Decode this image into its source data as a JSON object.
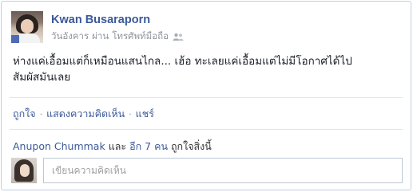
{
  "post": {
    "author": "Kwan Busaraporn",
    "day": "วันอังคาร",
    "via": "ผ่าน",
    "source": "โทรศัพท์มือถือ",
    "audience_icon": "friends-icon",
    "message_line1": "ห่างแค่เอื้อมแต่ก็เหมือนแสนไกล... เฮ้อ ทะเลยแค่เอื้อมแต่ไม่มีโอกาศได้ไป",
    "message_line2": "สัมผัสมันเลย"
  },
  "actions": {
    "like": "ถูกใจ",
    "comment": "แสดงความคิดเห็น",
    "share": "แชร์",
    "separator": "·"
  },
  "likes": {
    "liker": "Anupon Chummak",
    "and": "และ",
    "others": "อีก 7 คน",
    "suffix": "ถูกใจสิ่งนี้"
  },
  "composer": {
    "placeholder": "เขียนความคิดเห็น"
  },
  "colors": {
    "link": "#3b5998",
    "meta": "#90949c",
    "border": "#c4cde0"
  }
}
